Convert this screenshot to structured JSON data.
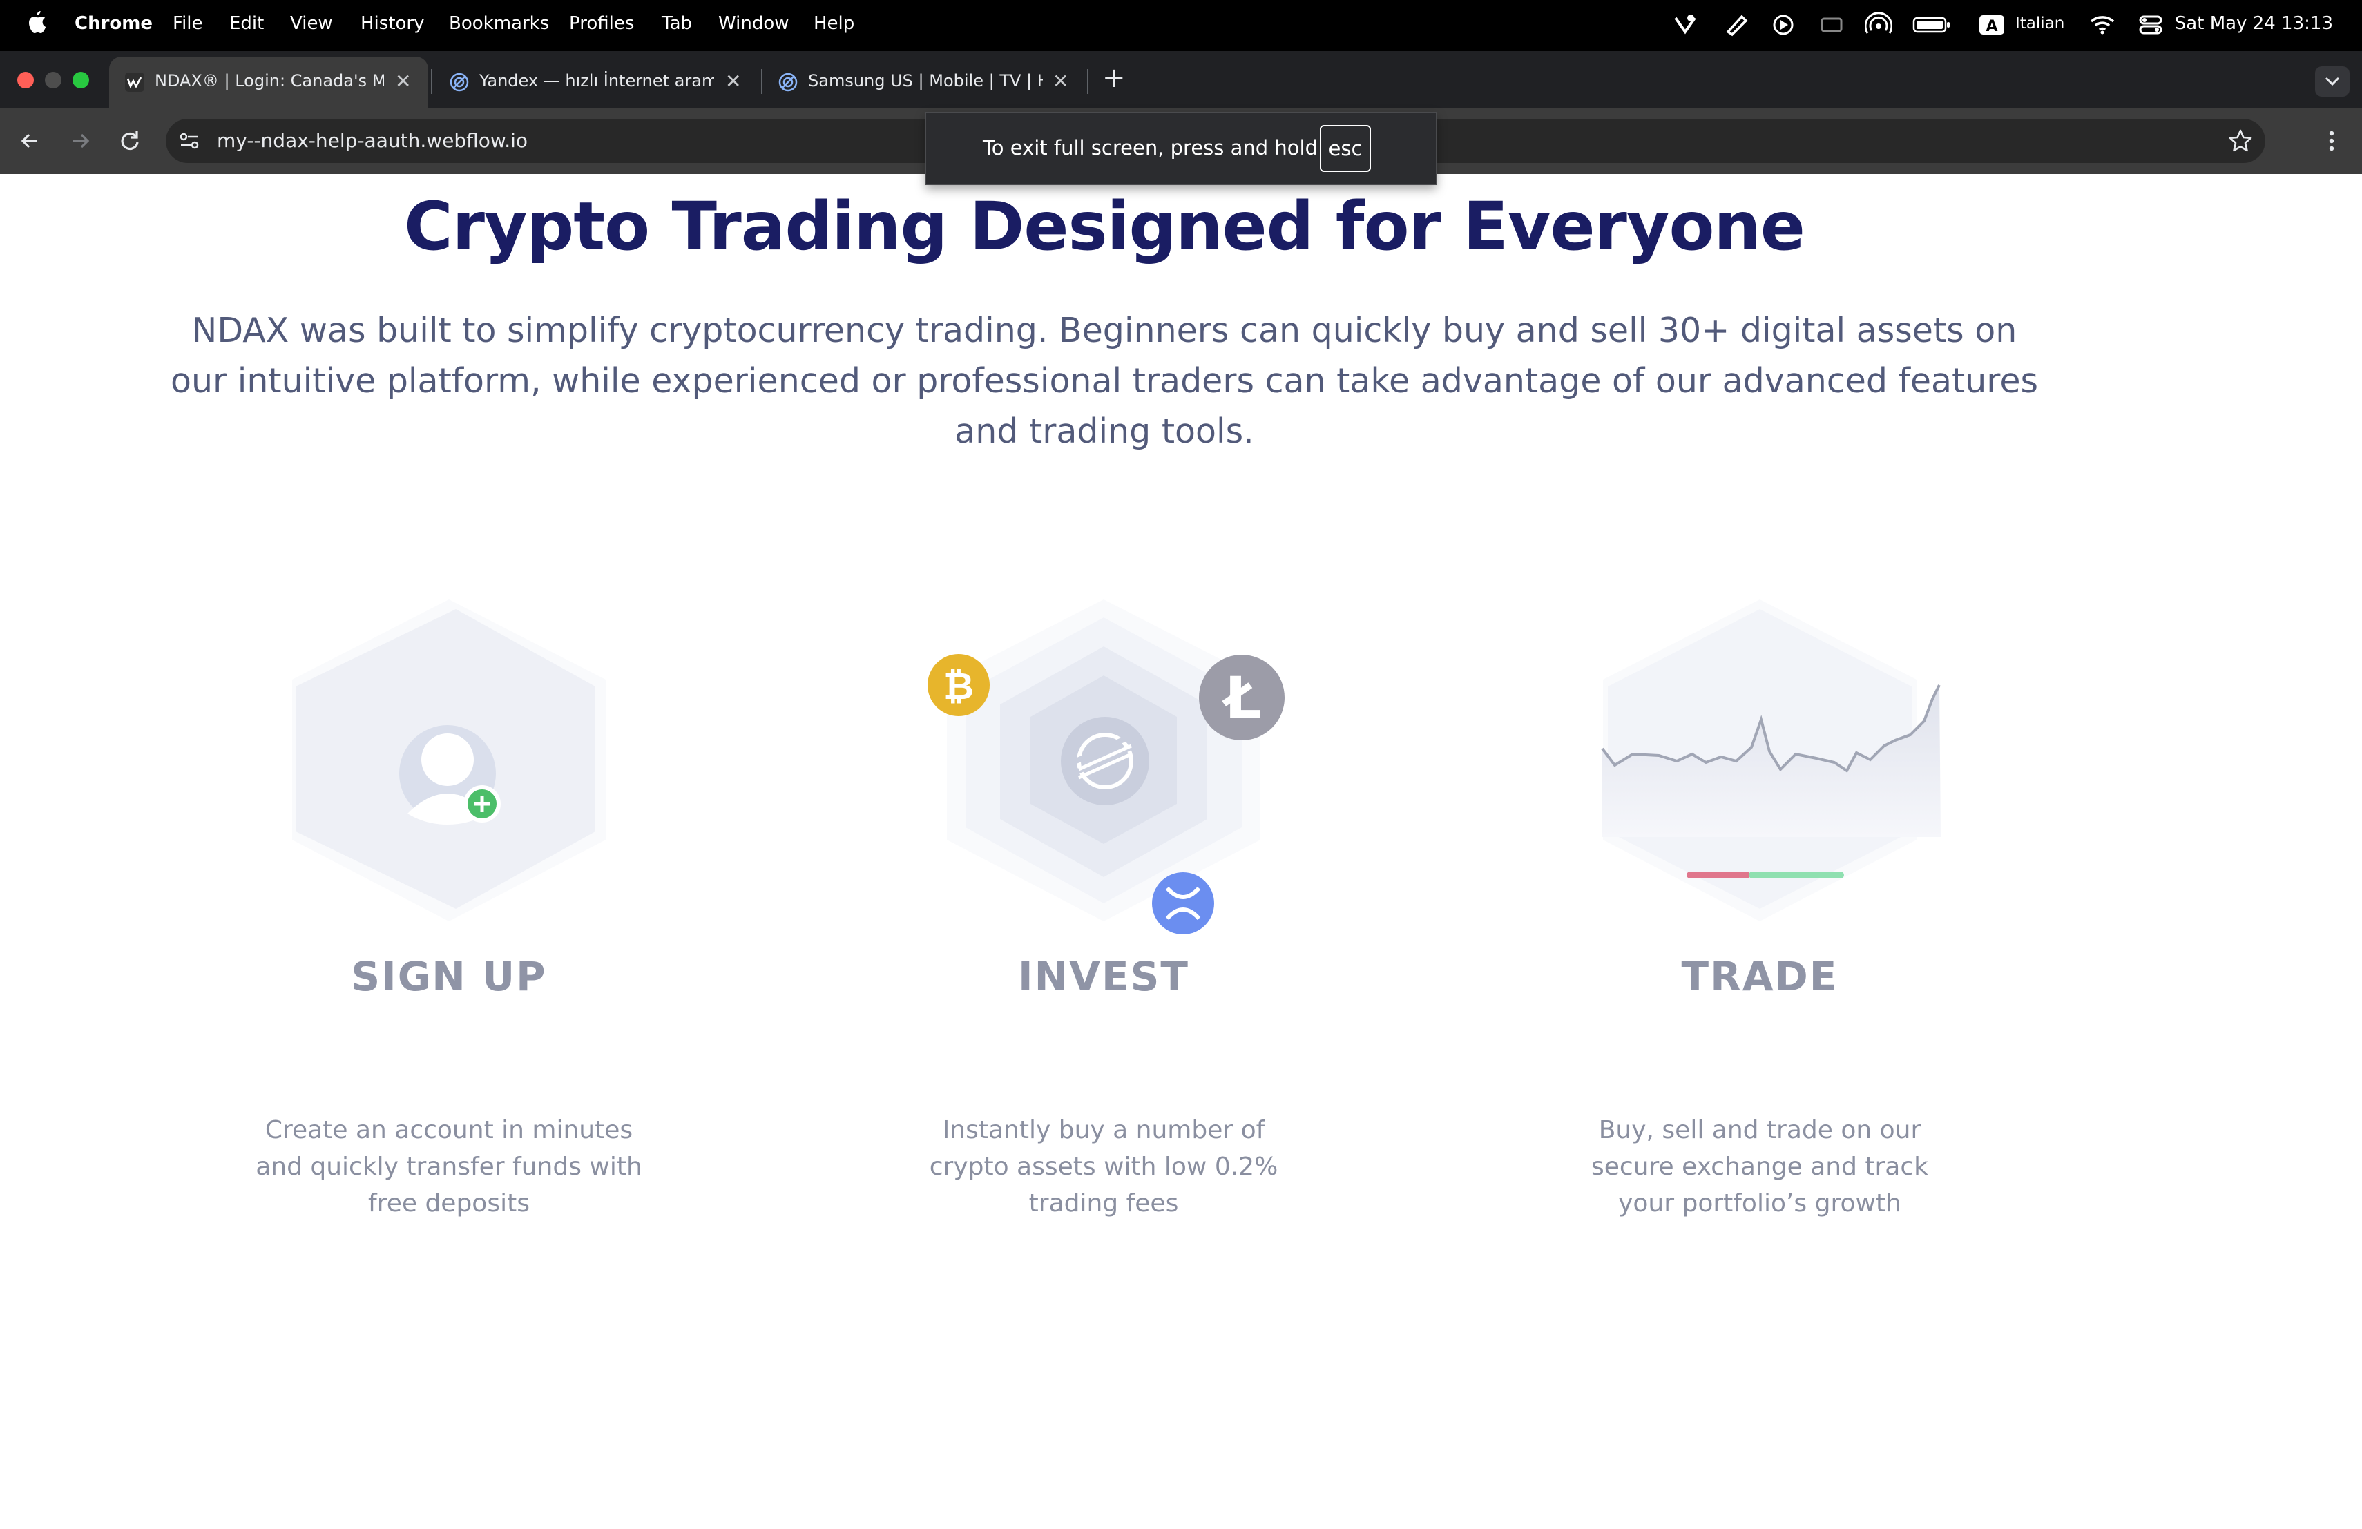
{
  "menubar": {
    "app_name": "Chrome",
    "menus": [
      "File",
      "Edit",
      "View",
      "History",
      "Bookmarks",
      "Profiles",
      "Tab",
      "Window",
      "Help"
    ],
    "input_language": "Italian",
    "input_badge": "A",
    "datetime": "Sat May 24  13:13"
  },
  "browser": {
    "tabs": [
      {
        "title": "NDAX® | Login: Canada's Most",
        "active": true
      },
      {
        "title": "Yandex — hızlı İnternet arama",
        "active": false
      },
      {
        "title": "Samsung US | Mobile | TV | Home",
        "active": false
      }
    ],
    "new_tab_label": "+",
    "url": "my--ndax-help-aauth.webflow.io"
  },
  "fullscreen_toast": {
    "message": "To exit full screen, press and hold",
    "key": "esc"
  },
  "page": {
    "headline": "Crypto Trading Designed for Everyone",
    "intro": "NDAX was built to simplify cryptocurrency trading. Beginners can quickly buy and sell 30+ digital assets on our intuitive platform, while experienced or professional traders can take advantage of our advanced features and trading tools.",
    "steps": [
      {
        "title": "SIGN UP",
        "text": "Create an account in minutes and quickly transfer funds with free deposits",
        "icon": "user-add-icon"
      },
      {
        "title": "INVEST",
        "text": "Instantly buy a number of crypto assets with low 0.2% trading fees",
        "icon": "crypto-coins-icon"
      },
      {
        "title": "TRADE",
        "text": "Buy, sell and trade on our secure exchange and track your portfolio’s growth",
        "icon": "price-chart-icon"
      }
    ]
  },
  "colors": {
    "headline": "#1a1d63",
    "body_text": "#525a7a",
    "bitcoin": "#e7b52c",
    "litecoin": "#9c9ca8",
    "ripple": "#6b8ef0",
    "add_badge": "#4cbe69",
    "bar_red": "#e0768c",
    "bar_green": "#8fe0b0"
  }
}
